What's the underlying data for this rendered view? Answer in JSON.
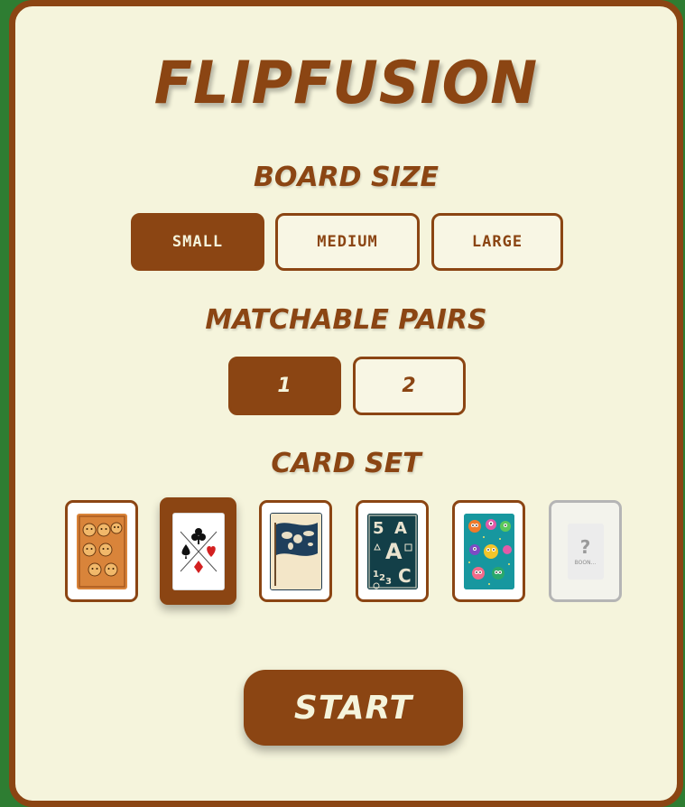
{
  "app": {
    "title": "FlipFusion"
  },
  "board_size": {
    "label": "Board Size",
    "options": [
      {
        "label": "Small",
        "selected": true
      },
      {
        "label": "Medium",
        "selected": false
      },
      {
        "label": "Large",
        "selected": false
      }
    ]
  },
  "matchable_pairs": {
    "label": "Matchable Pairs",
    "options": [
      {
        "label": "1",
        "selected": true
      },
      {
        "label": "2",
        "selected": false
      }
    ]
  },
  "card_set": {
    "label": "Card Set",
    "options": [
      {
        "icon": "animal-faces-icon",
        "selected": false
      },
      {
        "icon": "playing-card-suits-icon",
        "selected": true
      },
      {
        "icon": "world-map-flag-icon",
        "selected": false
      },
      {
        "icon": "letters-numbers-shapes-icon",
        "selected": false
      },
      {
        "icon": "monsters-icon",
        "selected": false
      },
      {
        "icon": "question-mark-icon",
        "selected": false,
        "disabled": true,
        "text": "?",
        "caption": "BOON..."
      }
    ]
  },
  "start": {
    "label": "Start"
  },
  "colors": {
    "background": "#2e7d32",
    "panel": "#f5f4dc",
    "accent": "#8b4513"
  }
}
